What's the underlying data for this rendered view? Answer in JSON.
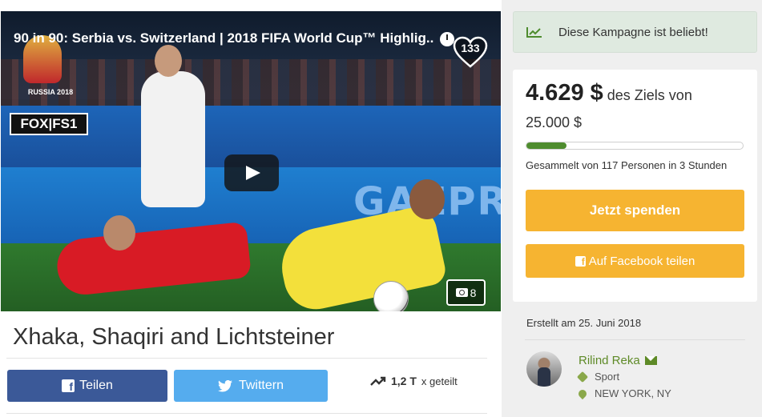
{
  "video": {
    "title": "90 in 90: Serbia vs. Switzerland | 2018 FIFA World Cup™ Highlig...",
    "likes": "133",
    "photo_count": "8",
    "overlay_event": "RUSSIA 2018",
    "overlay_channel": "FOX|FS1",
    "board_text": "GAZPR"
  },
  "campaign": {
    "title": "Xhaka, Shaqiri and Lichtsteiner"
  },
  "share": {
    "facebook_label": "Teilen",
    "twitter_label": "Twittern",
    "share_count": "1,2 T",
    "share_suffix": "x geteilt"
  },
  "sidebar": {
    "popular_text": "Diese Kampagne ist beliebt!",
    "amount": "4.629 $",
    "amount_suffix": "des Ziels von",
    "goal": "25.000 $",
    "progress_fraction": 0.185,
    "collected_text": "Gesammelt von 117 Personen in 3 Stunden",
    "donate_label": "Jetzt spenden",
    "fb_share_label": "Auf Facebook teilen",
    "created_text": "Erstellt am 25. Juni 2018",
    "owner_name": "Rilind Reka",
    "category": "Sport",
    "location": "NEW YORK, NY"
  },
  "colors": {
    "accent_green": "#5e8a27",
    "donate_orange": "#f6b431",
    "facebook_blue": "#3b5998",
    "twitter_blue": "#55acee",
    "progress_green": "#4e8c2e"
  }
}
